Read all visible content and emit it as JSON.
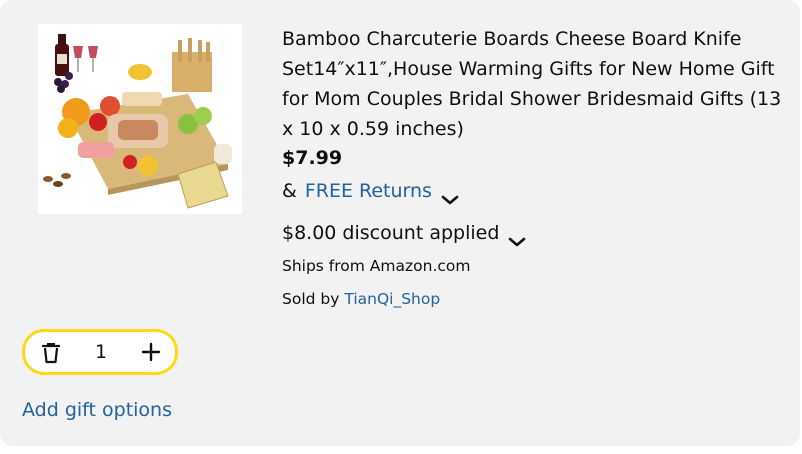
{
  "product": {
    "title": "Bamboo Charcuterie Boards Cheese Board Knife Set14″x11″,House Warming Gifts for New Home Gift for Mom Couples Bridal Shower Bridesmaid Gifts (13 x 10 x 0.59 inches)",
    "price": "$7.99",
    "returns_prefix": "&",
    "returns_link": "FREE Returns",
    "discount": "$8.00 discount applied",
    "ships_from": "Ships from Amazon.com",
    "sold_by_label": "Sold by",
    "seller": "TianQi_Shop"
  },
  "quantity": {
    "value": "1",
    "delete_icon": "trash-icon",
    "increment_icon": "plus-icon"
  },
  "gift_options_link": "Add gift options",
  "colors": {
    "link": "#2162a1",
    "stepper_border": "#ffd814",
    "card_bg": "#f2f2f2"
  }
}
